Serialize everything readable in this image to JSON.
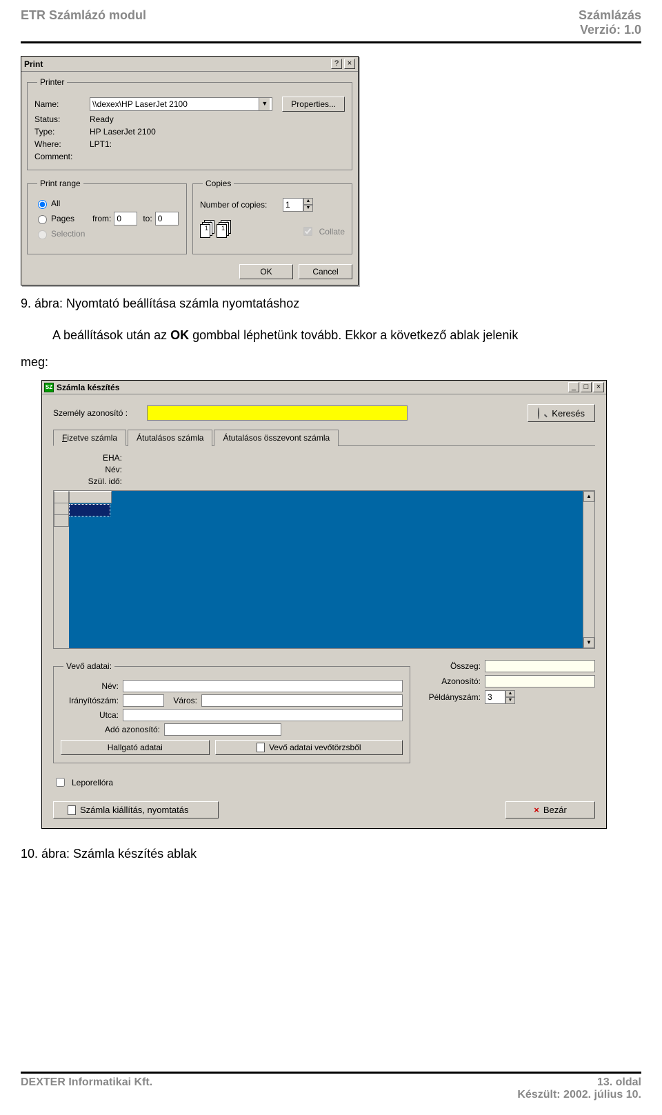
{
  "header": {
    "left": "ETR Számlázó modul",
    "right_l1": "Számlázás",
    "right_l2": "Verzió: 1.0"
  },
  "footer": {
    "left": "DEXTER Informatikai Kft.",
    "right_l1": "13. oldal",
    "right_l2": "Készült: 2002. július 10."
  },
  "caption1": "9. ábra: Nyomtató beállítása számla nyomtatáshoz",
  "body_text_1a": "A beállítások után az ",
  "body_text_1b": "OK",
  "body_text_1c": " gombbal léphetünk tovább. Ekkor a következő ablak jelenik",
  "body_text_2": "meg:",
  "caption2": "10. ábra: Számla készítés ablak",
  "print_dialog": {
    "title": "Print",
    "help_btn": "?",
    "close_btn": "×",
    "printer_group": "Printer",
    "name_label": "Name:",
    "name_value": "\\\\dexex\\HP LaserJet 2100",
    "properties_btn": "Properties...",
    "status_label": "Status:",
    "status_value": "Ready",
    "type_label": "Type:",
    "type_value": "HP LaserJet 2100",
    "where_label": "Where:",
    "where_value": "LPT1:",
    "comment_label": "Comment:",
    "comment_value": "",
    "range_group": "Print range",
    "range_all": "All",
    "range_pages": "Pages",
    "range_from": "from:",
    "range_from_v": "0",
    "range_to": "to:",
    "range_to_v": "0",
    "range_selection": "Selection",
    "copies_group": "Copies",
    "copies_label": "Number of copies:",
    "copies_value": "1",
    "collate_label": "Collate",
    "ok_btn": "OK",
    "cancel_btn": "Cancel"
  },
  "szamla_win": {
    "title": "Számla készítés",
    "title_icon": "SZ",
    "min_btn": "_",
    "max_btn": "□",
    "close_btn": "×",
    "label_szemely": "Személy azonosító :",
    "kereses_btn": "Keresés",
    "tab1": "Fizetve számla",
    "tab1_accel": "F",
    "tab2": "Átutalásos számla",
    "tab3": "Átutalásos összevont számla",
    "eha_label": "EHA:",
    "nev_label": "Név:",
    "szul_label": "Szül. idő:",
    "vevo_group": "Vevő adatai:",
    "v_nev": "Név:",
    "v_irsz": "Irányítószám:",
    "v_varos": "Város:",
    "v_utca": "Utca:",
    "v_ado": "Adó azonosító:",
    "hallgato_btn": "Hallgató adatai",
    "vevotorzs_btn": "Vevő adatai vevőtörzsből",
    "osszeg_label": "Összeg:",
    "azonosito_label": "Azonosító:",
    "peldany_label": "Példányszám:",
    "peldany_value": "3",
    "leporello": "Leporellóra",
    "print_btn": "Számla kiállítás, nyomtatás",
    "close2_btn": "Bezár"
  }
}
